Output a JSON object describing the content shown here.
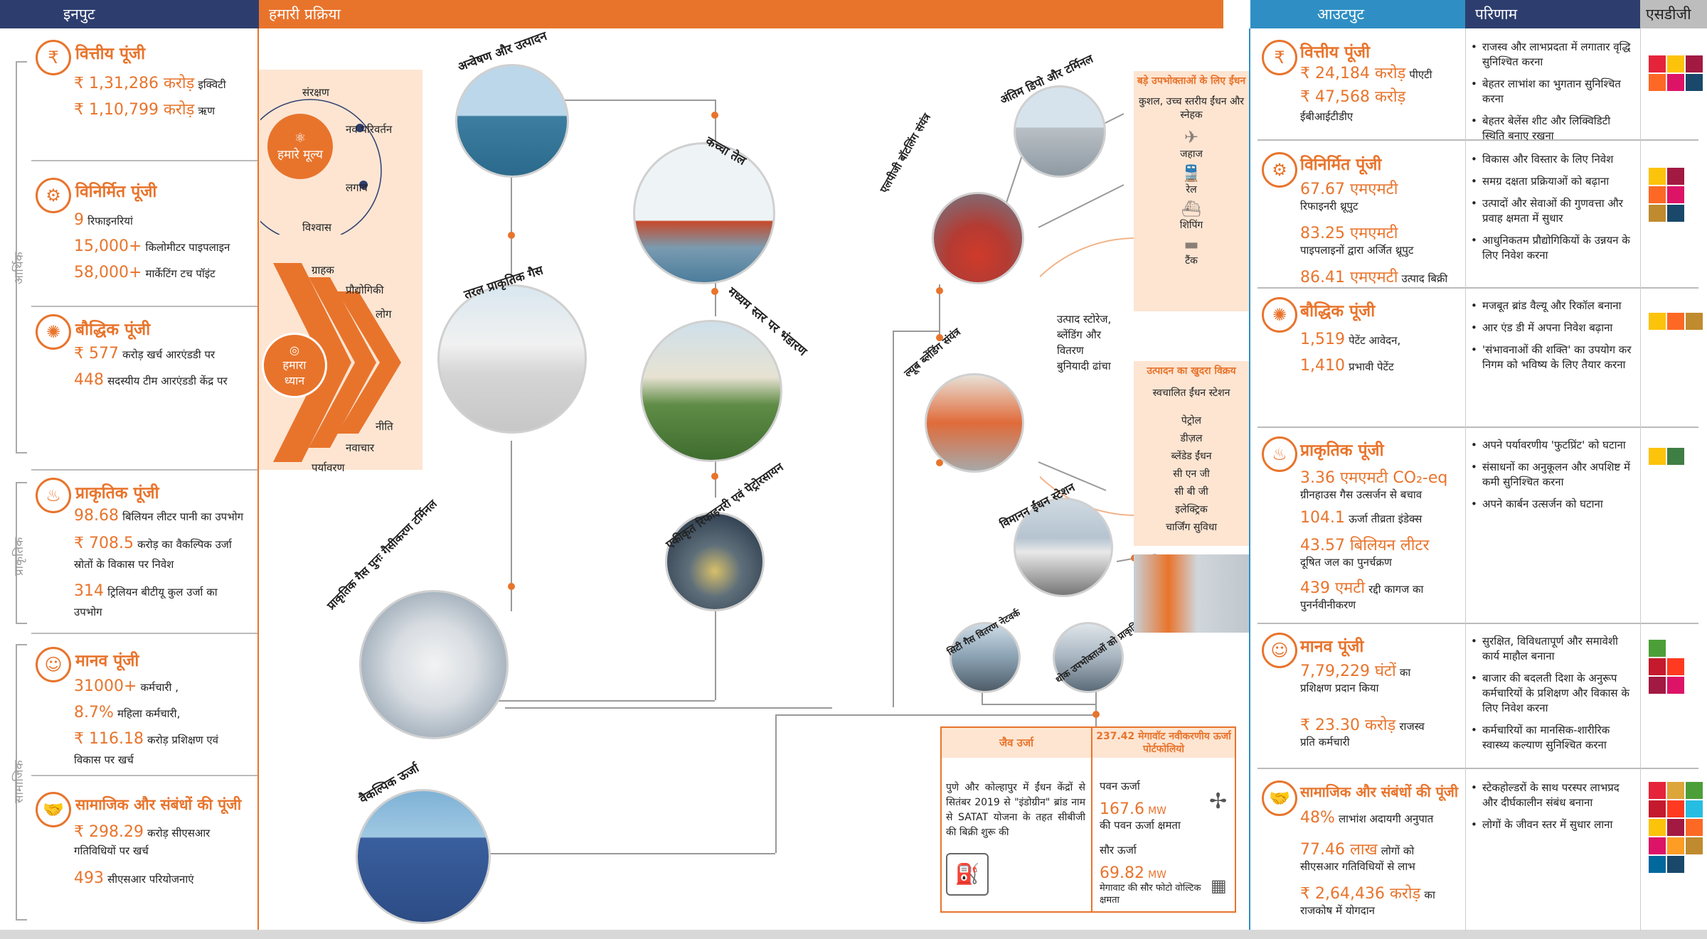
{
  "headers": {
    "inputs": "इनपुट",
    "process": "हमारी प्रक्रिया",
    "outputs": "आउटपुट",
    "outcomes": "परिणाम",
    "sdg": "एसडीजी"
  },
  "side_labels": {
    "economic": "आर्थिक",
    "natural": "प्राकृतिक",
    "social": "सामाजिक"
  },
  "inputs": {
    "financial": {
      "title": "वित्तीय पूंजी",
      "rows": [
        {
          "val": "₹ 1,31,286 करोड़",
          "txt": "इक्विटी"
        },
        {
          "val": "₹ 1,10,799 करोड़",
          "txt": "ऋण"
        }
      ]
    },
    "manufactured": {
      "title": "विनिर्मित पूंजी",
      "rows": [
        {
          "val": "9",
          "txt": "रिफाइनरियां"
        },
        {
          "val": "15,000+",
          "txt": "किलोमीटर पाइपलाइन"
        },
        {
          "val": "58,000+",
          "txt": "मार्केटिंग टच पॉइंट"
        }
      ]
    },
    "intellectual": {
      "title": "बौद्धिक पूंजी",
      "rows": [
        {
          "val": "₹ 577",
          "txt": "करोड़ खर्च आरएंडडी पर"
        },
        {
          "val": "448",
          "txt": "सदस्यीय टीम आरएंडडी केंद्र पर"
        }
      ]
    },
    "natural": {
      "title": "प्राकृतिक पूंजी",
      "rows": [
        {
          "val": "98.68",
          "txt": "बिलियन लीटर पानी का उपभोग"
        },
        {
          "val": "₹ 708.5",
          "txt": "करोड़ का वैकल्पिक उर्जा"
        },
        {
          "val": "",
          "txt": "स्रोतों के विकास पर निवेश"
        },
        {
          "val": "314",
          "txt": "ट्रिलियन बीटीयू कुल उर्जा का"
        },
        {
          "val": "",
          "txt": "उपभोग"
        }
      ]
    },
    "human": {
      "title": "मानव पूंजी",
      "rows": [
        {
          "val": "31000+",
          "txt": "कर्मचारी ,"
        },
        {
          "val": "8.7%",
          "txt": "महिला कर्मचारी,"
        },
        {
          "val": "₹ 116.18",
          "txt": "करोड़ प्रशिक्षण एवं"
        },
        {
          "val": "",
          "txt": "विकास पर खर्च"
        }
      ]
    },
    "social": {
      "title": "सामाजिक और संबंधों की पूंजी",
      "rows": [
        {
          "val": "₹ 298.29",
          "txt": "करोड़ सीएसआर"
        },
        {
          "val": "",
          "txt": "गतिविधियों पर खर्च"
        },
        {
          "val": "493",
          "txt": "सीएसआर परियोजनाएं"
        }
      ]
    }
  },
  "values": {
    "center": "हमारे मूल्य",
    "items": [
      "संरक्षण",
      "नव परिवर्तन",
      "लगाव",
      "विश्वास"
    ]
  },
  "focus": {
    "center": "हमारा ध्यान",
    "items": [
      "ग्राहक",
      "प्रौद्योगिकी",
      "लोग",
      "नीति",
      "नवाचार",
      "पर्यावरण"
    ]
  },
  "process": {
    "exploration": "अन्वेषण और उत्पादन",
    "crude": "कच्चा तेल",
    "lng": "तरल प्राकृतिक गैस",
    "midstream": "मध्यम स्तर पर भंडारण",
    "refinery": "एकीकृत रिफाइनरी एवं पेट्रोरसायन",
    "regas": "प्राकृतिक गैस पुनः गैसीकरण टर्मिनल",
    "alt": "वैकल्पिक ऊर्जा",
    "depots": "अंतिम डिपो और टर्मिनल",
    "lpg": "एलपीजी बॉटलिंग संयंत्र",
    "lube": "ल्यूब ब्लेंडिंग संयंत्र",
    "aviation": "विमानन ईंधन स्टेशन",
    "cgd": "सिटी गैस वितरण नेटवर्क",
    "bulk_gas": "थोक उपभोक्ताओं को प्राकृतिक गैस",
    "infra": [
      "उत्पाद स्टोरेज,",
      "ब्लेंडिंग और",
      "वितरण",
      "बुनियादी ढांचा"
    ],
    "bulk": {
      "title": "बड़े उपभोक्ताओं के लिए ईंधन",
      "sub": "कुशल, उच्च स्तरीय ईंधन और स्नेहक",
      "modes": [
        "जहाज",
        "रेल",
        "शिपिंग",
        "टैंक"
      ]
    },
    "retail": {
      "title": "उत्पादन का खुदरा विक्रय",
      "items": [
        "स्वचालित ईंधन स्टेशन",
        "पेट्रोल",
        "डीज़ल",
        "ब्लेंडेड ईंधन",
        "सी एन जी",
        "सी बी जी",
        "इलेक्ट्रिक",
        "चार्जिंग सुविधा"
      ]
    },
    "bio": {
      "title": "जैव उर्जा",
      "text": "पुणे और कोल्हापुर में ईंधन केंद्रों से सितंबर 2019 से \"इंडोग्रीन\" ब्रांड नाम से SATAT योजना के तहत सीबीजी की बिक्री शुरू की"
    },
    "renew": {
      "title": "237.42 मेगावॉट नवीकरणीय ऊर्जा पोर्टफोलियो",
      "wind_label": "पवन ऊर्जा",
      "wind_val": "167.6",
      "wind_unit": "MW",
      "wind_txt": "की पवन ऊर्जा क्षमता",
      "solar_label": "सौर ऊर्जा",
      "solar_val": "69.82",
      "solar_unit": "MW",
      "solar_txt": "मेगावाट की सौर फोटो वोल्टिक क्षमता"
    }
  },
  "outputs": {
    "financial": {
      "title": "वित्तीय पूंजी",
      "rows": [
        {
          "val": "₹ 24,184 करोड़",
          "txt": "पीएटी"
        },
        {
          "val": "₹ 47,568 करोड़",
          "txt": ""
        },
        {
          "val": "",
          "txt": "ईबीआईटीडीए"
        }
      ]
    },
    "manufactured": {
      "title": "विनिर्मित पूंजी",
      "rows": [
        {
          "val": "67.67 एमएमटी",
          "txt": ""
        },
        {
          "val": "",
          "txt": "रिफाइनरी थ्रूपुट"
        },
        {
          "val": "83.25 एमएमटी",
          "txt": ""
        },
        {
          "val": "",
          "txt": "पाइपलाइनों द्वारा अर्जित थ्रूपुट"
        },
        {
          "val": "86.41 एमएमटी",
          "txt": "उत्पाद बिक्री"
        }
      ]
    },
    "intellectual": {
      "title": "बौद्धिक पूंजी",
      "rows": [
        {
          "val": "1,519",
          "txt": "पेटेंट आवेदन,"
        },
        {
          "val": "1,410",
          "txt": "प्रभावी पेटेंट"
        }
      ]
    },
    "natural": {
      "title": "प्राकृतिक पूंजी",
      "rows": [
        {
          "val": "3.36 एमएमटी CO₂-eq",
          "txt": ""
        },
        {
          "val": "",
          "txt": "ग्रीनहाउस गैस उत्सर्जन से बचाव"
        },
        {
          "val": "104.1",
          "txt": "ऊर्जा तीव्रता इंडेक्स"
        },
        {
          "val": "43.57 बिलियन लीटर",
          "txt": ""
        },
        {
          "val": "",
          "txt": "दूषित जल का पुनर्चक्रण"
        },
        {
          "val": "439 एमटी",
          "txt": "रद्दी कागज का"
        },
        {
          "val": "",
          "txt": "पुनर्नवीनीकरण"
        }
      ]
    },
    "human": {
      "title": "मानव पूंजी",
      "rows": [
        {
          "val": "7,79,229 घंटों",
          "txt": "का"
        },
        {
          "val": "",
          "txt": "प्रशिक्षण प्रदान किया"
        },
        {
          "val": "₹ 23.30 करोड़",
          "txt": "राजस्व"
        },
        {
          "val": "",
          "txt": "प्रति कर्मचारी"
        }
      ]
    },
    "social": {
      "title": "सामाजिक और संबंधों की पूंजी",
      "rows": [
        {
          "val": "48%",
          "txt": "लाभांश अदायगी अनुपात"
        },
        {
          "val": "77.46 लाख",
          "txt": "लोगों को"
        },
        {
          "val": "",
          "txt": "सीएसआर गतिविधियों से लाभ"
        },
        {
          "val": "₹ 2,64,436 करोड़",
          "txt": "का"
        },
        {
          "val": "",
          "txt": "राजकोष में योगदान"
        }
      ]
    }
  },
  "outcomes": {
    "financial": [
      "राजस्व और लाभप्रदता में लगातार वृद्धि सुनिश्चित करना",
      "बेहतर लाभांश का भुगतान सुनिश्चित करना",
      "बेहतर बेलेंस शीट और लिक्विडिटी स्थिति बनाए रखना"
    ],
    "manufactured": [
      "विकास और विस्तार के लिए निवेश",
      "समग्र दक्षता प्रक्रियाओं को बढ़ाना",
      "उत्पादों और सेवाओं की गुणवत्ता और प्रवाह क्षमता में सुधार",
      "आधुनिकतम प्रौद्योगिकियों के उन्नयन के लिए निवेश करना"
    ],
    "intellectual": [
      "मजबूत ब्रांड वैल्यू और रिकॉल बनाना",
      "आर एंड डी में अपना निवेश बढ़ाना",
      "'संभावनाओं की शक्ति' का उपयोग कर निगम को भविष्य के लिए तैयार करना"
    ],
    "natural": [
      "अपने पर्यावरणीय 'फुटप्रिंट' को घटाना",
      "संसाधनों का अनुकूलन और अपशिष्ट में कमी सुनिश्चित करना",
      "अपने कार्बन उत्सर्जन को घटाना"
    ],
    "human": [
      "सुरक्षित, विविधतापूर्ण और समावेशी कार्य माहौल बनाना",
      "बाजार की बदलती दिशा के अनुरूप कर्मचारियों के प्रशिक्षण और विकास के लिए निवेश करना",
      "कर्मचारियों का मानसिक-शारीरिक स्वास्थ्य कल्याण सुनिश्चित करना"
    ],
    "social": [
      "स्टेकहोल्डरों के साथ परस्पर लाभप्रद और दीर्घकालीन संबंध बनाना",
      "लोगों के जीवन स्तर में सुधार लाना"
    ]
  },
  "colors": {
    "orange": "#e8742c",
    "navy": "#2d3e6e",
    "blue": "#2f8fc4",
    "grey": "#bdbdbd"
  }
}
